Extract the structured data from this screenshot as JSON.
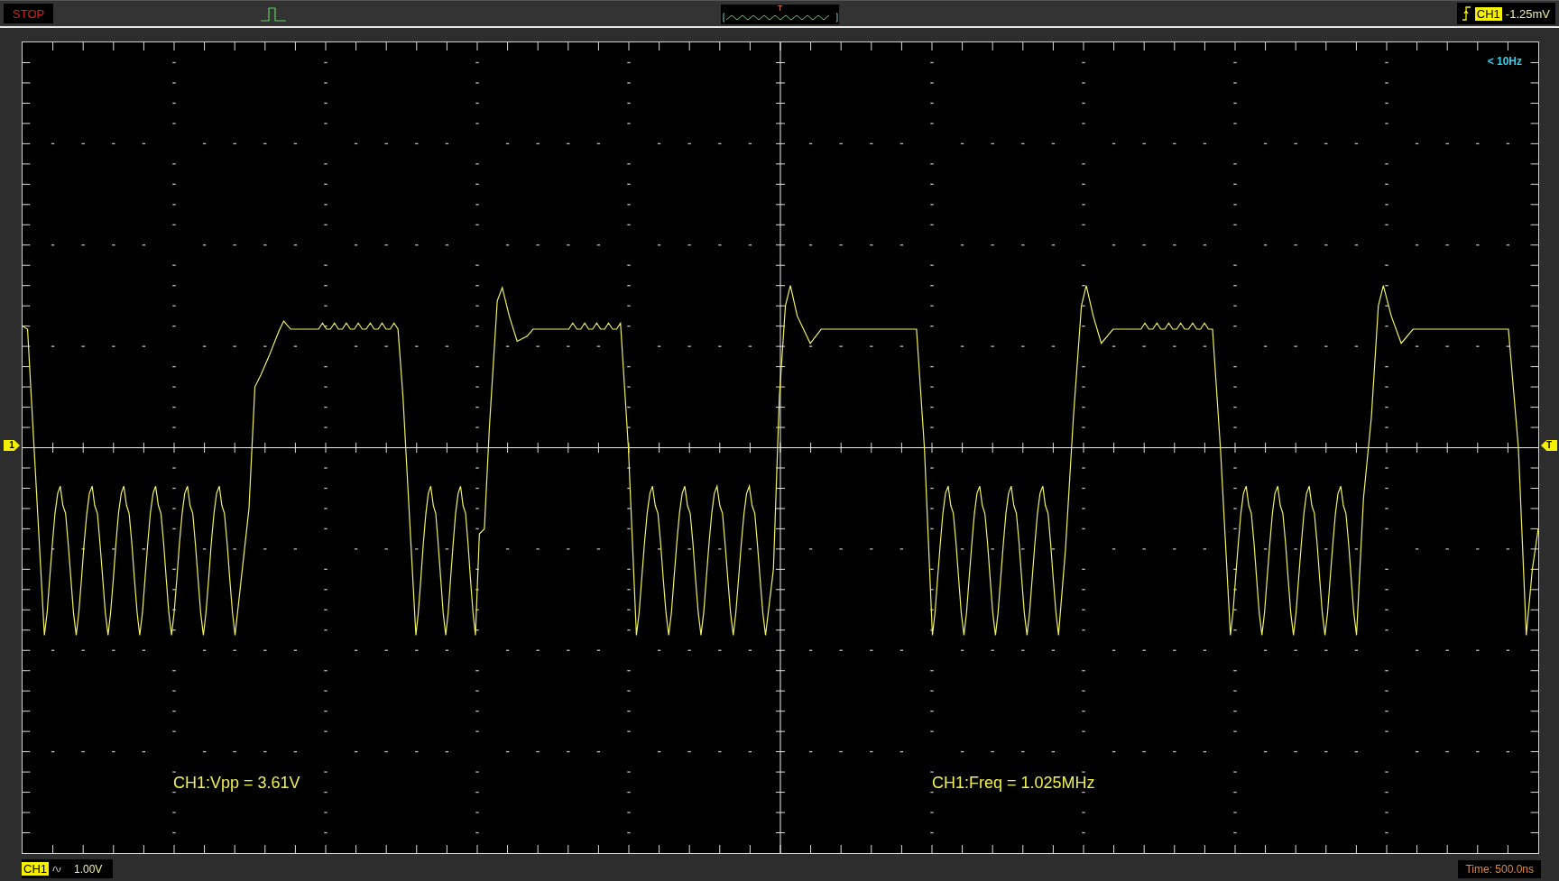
{
  "status": "STOP",
  "buffer_marker": "T",
  "trigger": {
    "channel": "CH1",
    "level": "-1.25mV"
  },
  "frequency_indicator": "< 10Hz",
  "channel_marker": "1",
  "trigger_marker": "T",
  "measurements": [
    "CH1:Vpp = 3.61V",
    "CH1:Freq = 1.025MHz"
  ],
  "channel": {
    "label": "CH1",
    "scale": "1.00V"
  },
  "timebase": "Time: 500.0ns"
}
